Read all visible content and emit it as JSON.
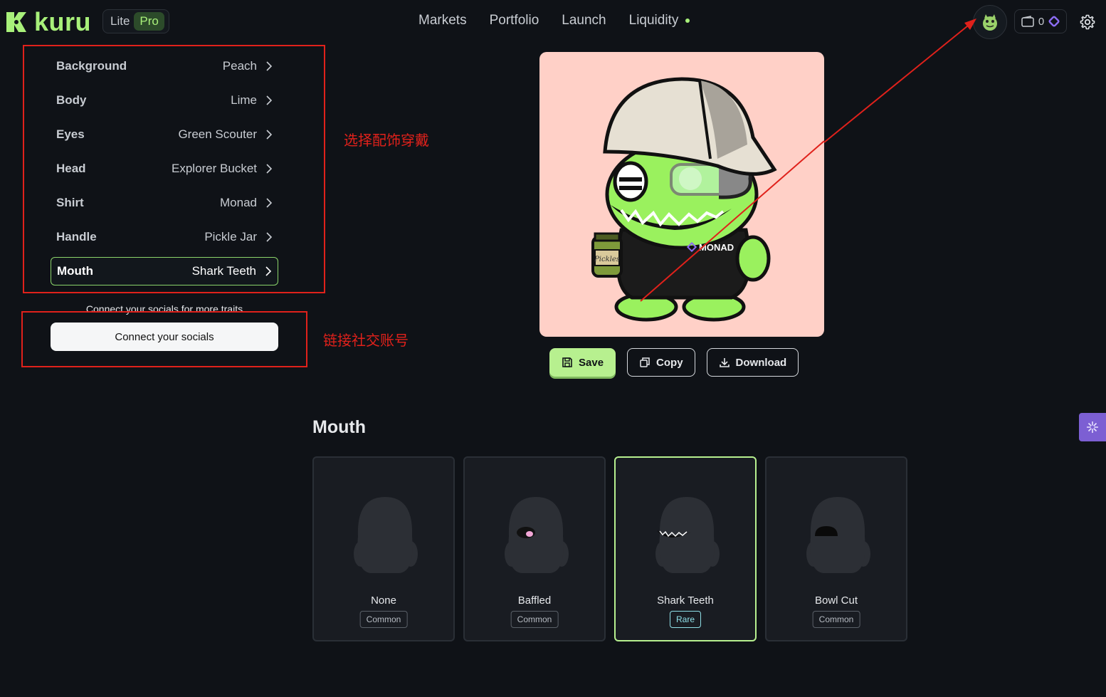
{
  "header": {
    "brand": "kuru",
    "mode_lite": "Lite",
    "mode_pro": "Pro",
    "nav": [
      "Markets",
      "Portfolio",
      "Launch",
      "Liquidity"
    ],
    "wallet_balance": "0"
  },
  "traits": [
    {
      "name": "Background",
      "value": "Peach"
    },
    {
      "name": "Body",
      "value": "Lime"
    },
    {
      "name": "Eyes",
      "value": "Green Scouter"
    },
    {
      "name": "Head",
      "value": "Explorer Bucket"
    },
    {
      "name": "Shirt",
      "value": "Monad"
    },
    {
      "name": "Handle",
      "value": "Pickle Jar"
    },
    {
      "name": "Mouth",
      "value": "Shark Teeth"
    }
  ],
  "active_trait": "Mouth",
  "socials": {
    "hint": "Connect your socials for more traits",
    "button": "Connect your socials"
  },
  "annotations": {
    "traits_note": "选择配饰穿戴",
    "socials_note": "链接社交账号"
  },
  "preview": {
    "shirt_text": "MONAD",
    "jar_text": "Pickles"
  },
  "actions": {
    "save": "Save",
    "copy": "Copy",
    "download": "Download"
  },
  "section": {
    "title": "Mouth",
    "options": [
      {
        "name": "None",
        "rarity": "Common"
      },
      {
        "name": "Baffled",
        "rarity": "Common"
      },
      {
        "name": "Shark Teeth",
        "rarity": "Rare"
      },
      {
        "name": "Bowl Cut",
        "rarity": "Common"
      }
    ],
    "selected": "Shark Teeth"
  },
  "colors": {
    "accent": "#a8f07a",
    "background": "#0f1217",
    "annotation": "#e0211b",
    "preview_bg": "#ffd0c7",
    "rare": "#8fe0e8"
  }
}
